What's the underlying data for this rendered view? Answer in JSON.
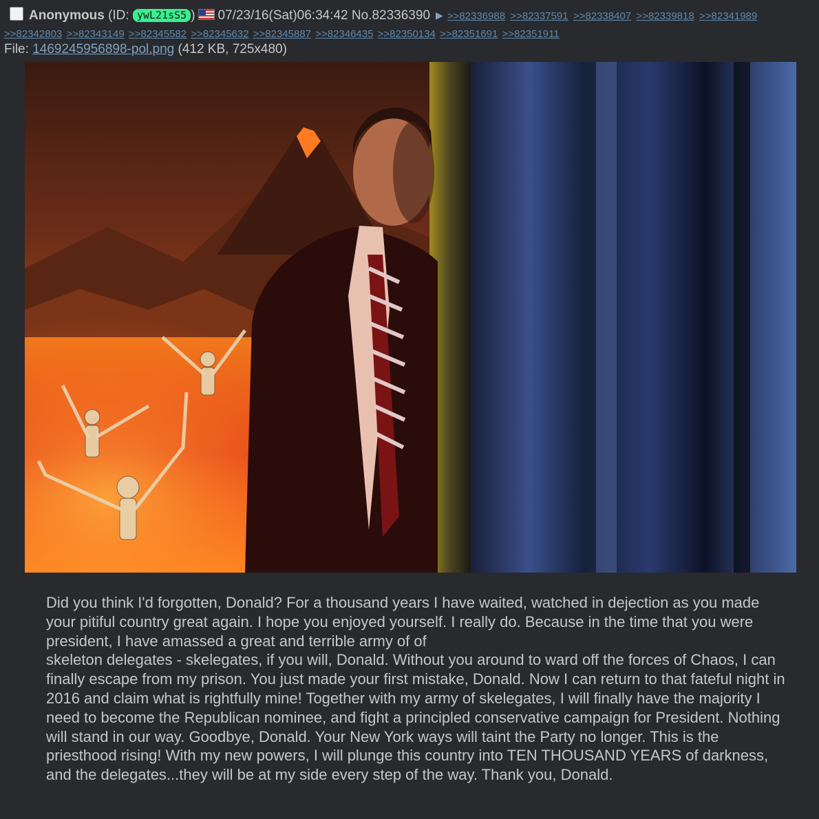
{
  "post": {
    "name": "Anonymous",
    "id_prefix": "(ID: ",
    "poster_id": "ywL21sS5",
    "id_suffix": ")",
    "flag_icon": "us-flag-icon",
    "datetime": "07/23/16(Sat)06:34:42",
    "post_no": "No.82336390",
    "arrow_icon": "triangle-right-icon",
    "header_backlinks": [
      ">>82336988",
      ">>82337591",
      ">>82338407",
      ">>82339818",
      ">>82341989"
    ],
    "backlinks": [
      ">>82342803",
      ">>82343149",
      ">>82345582",
      ">>82345632",
      ">>82345887",
      ">>82346435",
      ">>82350134",
      ">>82351691",
      ">>82351911"
    ]
  },
  "file": {
    "label": "File: ",
    "filename": "1469245956898-pol.png",
    "meta": " (412 KB, 725x480)"
  },
  "colors": {
    "background": "#282a2e",
    "text": "#c5c8c6",
    "link": "#5f89ac",
    "id_badge": "#3aef8f"
  },
  "comment": {
    "lines": [
      "Did you think I'd forgotten, Donald? For a thousand years I have waited, watched in dejection as you made your pitiful country great again. I hope you enjoyed yourself. I really do. Because in the time that you were president, I have amassed a great and terrible army of of",
      "skeleton delegates - skelegates, if you will, Donald. Without you around to ward off the forces of Chaos, I can finally escape from my prison. You just made your first mistake, Donald. Now I can return to that fateful night in 2016 and claim what is rightfully mine! Together with my army of skelegates, I will finally have the majority I need to become the Republican nominee, and fight a principled conservative campaign for President. Nothing will stand in our way. Goodbye, Donald. Your New York ways will taint the Party no longer. This is the priesthood rising! With my new powers, I will plunge this country into TEN THOUSAND YEARS of darkness, and the delegates...they will be at my side every step of the way. Thank you, Donald."
    ]
  }
}
